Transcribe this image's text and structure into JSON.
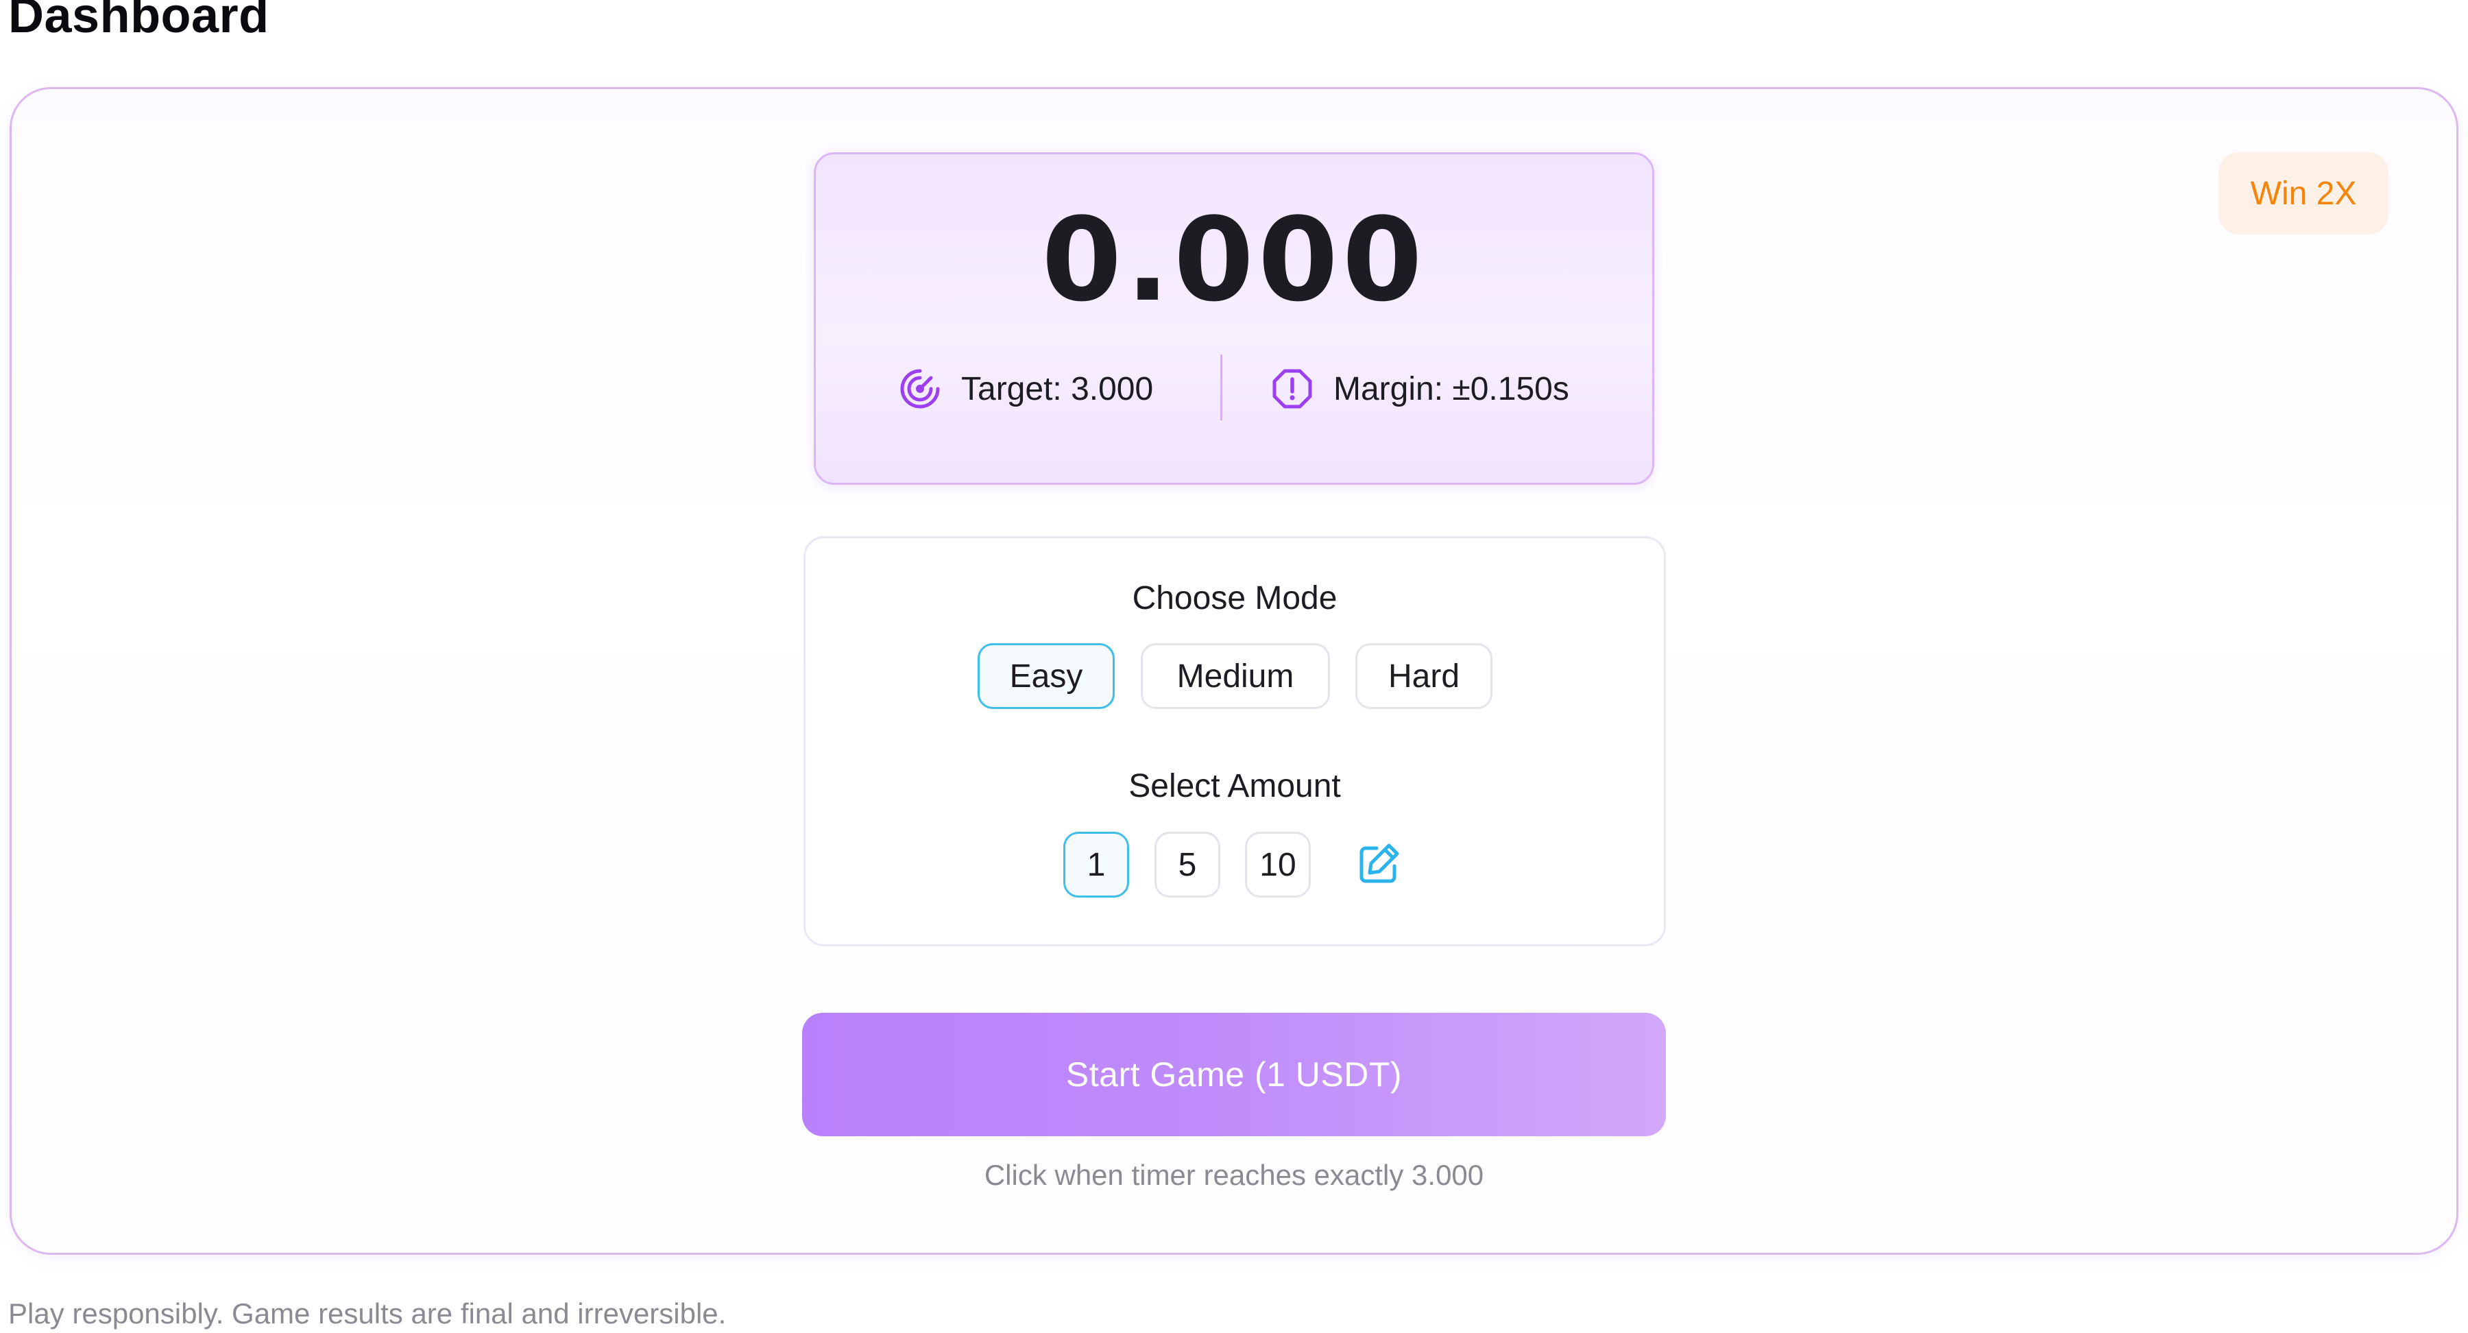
{
  "page": {
    "title": "Dashboard"
  },
  "game": {
    "badge": "Win 2X",
    "timer": "0.000",
    "target_label": "Target: 3.000",
    "margin_label": "Margin: ±0.150s",
    "mode_heading": "Choose Mode",
    "modes": [
      "Easy",
      "Medium",
      "Hard"
    ],
    "selected_mode": "Easy",
    "amount_heading": "Select Amount",
    "amounts": [
      "1",
      "5",
      "10"
    ],
    "selected_amount": "1",
    "start_label": "Start Game (1 USDT)",
    "hint": "Click when timer reaches exactly 3.000"
  },
  "footer": {
    "disclaimer": "Play responsibly. Game results are final and irreversible."
  },
  "icons": {
    "target": "target-icon",
    "margin": "alert-octagon-icon",
    "custom_amount": "edit-icon"
  },
  "colors": {
    "accent_purple": "#9b3ff0",
    "selected_border": "#3ebfe8",
    "badge_text": "#f4850a",
    "badge_bg": "#fdf0e6",
    "start_button_from": "#b980fb",
    "start_button_to": "#d2a8fa"
  }
}
